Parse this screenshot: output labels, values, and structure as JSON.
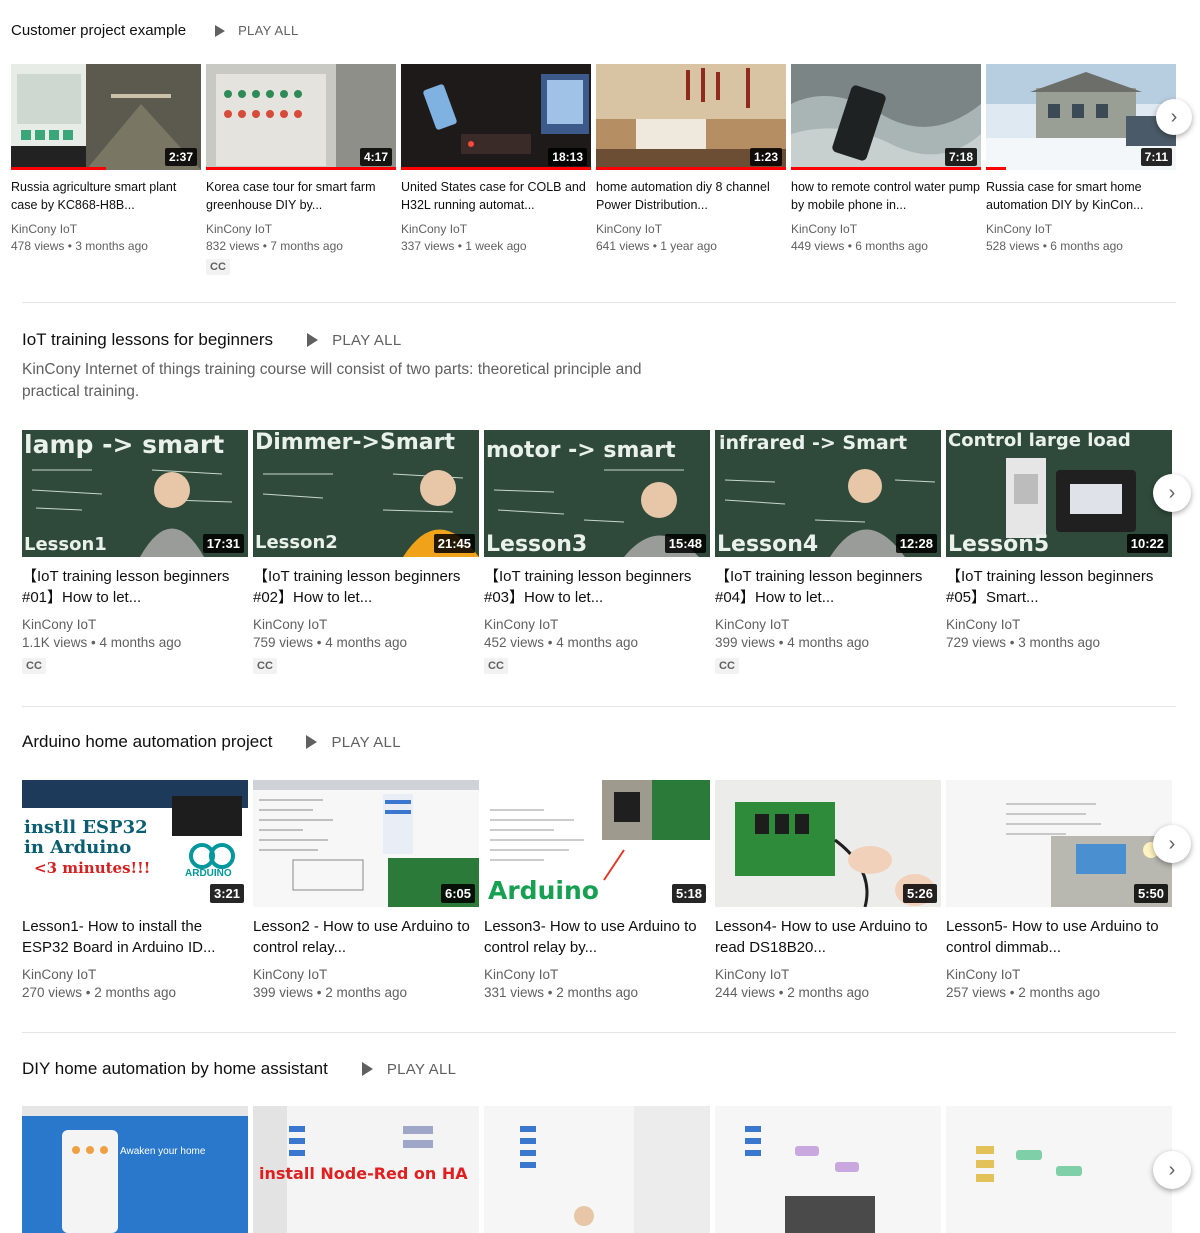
{
  "shelves": [
    {
      "title": "Customer project example",
      "play_all": "PLAY ALL",
      "videos": [
        {
          "title": "Russia agriculture smart plant case by KC868-H8B...",
          "channel": "KinCony IoT",
          "meta": "478 views • 3 months ago",
          "duration": "2:37",
          "cc": ""
        },
        {
          "title": "Korea case tour for smart farm greenhouse DIY by...",
          "channel": "KinCony IoT",
          "meta": "832 views • 7 months ago",
          "duration": "4:17",
          "cc": "CC"
        },
        {
          "title": "United States case for COLB and H32L running automat...",
          "channel": "KinCony IoT",
          "meta": "337 views • 1 week ago",
          "duration": "18:13",
          "cc": ""
        },
        {
          "title": "home automation diy 8 channel Power Distribution...",
          "channel": "KinCony IoT",
          "meta": "641 views • 1 year ago",
          "duration": "1:23",
          "cc": ""
        },
        {
          "title": "how to remote control water pump by mobile phone in...",
          "channel": "KinCony IoT",
          "meta": "449 views • 6 months ago",
          "duration": "7:18",
          "cc": ""
        },
        {
          "title": "Russia case for smart home automation DIY by KinCon...",
          "channel": "KinCony IoT",
          "meta": "528 views • 6 months ago",
          "duration": "7:11",
          "cc": ""
        }
      ]
    },
    {
      "title": "IoT training lessons for beginners",
      "play_all": "PLAY ALL",
      "description": "KinCony Internet of things training course will consist of two parts: theoretical principle and practical training.",
      "videos": [
        {
          "title": "【IoT training lesson beginners #01】How to let...",
          "channel": "KinCony IoT",
          "meta": "1.1K views • 4 months ago",
          "duration": "17:31",
          "cc": "CC",
          "thumb_top": "lamp -> smart",
          "thumb_bottom": "Lesson1"
        },
        {
          "title": "【IoT training lesson beginners #02】How to let...",
          "channel": "KinCony IoT",
          "meta": "759 views • 4 months ago",
          "duration": "21:45",
          "cc": "CC",
          "thumb_top": "Dimmer->Smart",
          "thumb_bottom": "Lesson2"
        },
        {
          "title": "【IoT training lesson beginners #03】How to let...",
          "channel": "KinCony IoT",
          "meta": "452 views • 4 months ago",
          "duration": "15:48",
          "cc": "CC",
          "thumb_top": "motor -> smart",
          "thumb_bottom": "Lesson3"
        },
        {
          "title": "【IoT training lesson beginners #04】How to let...",
          "channel": "KinCony IoT",
          "meta": "399 views • 4 months ago",
          "duration": "12:28",
          "cc": "CC",
          "thumb_top": "infrared -> Smart",
          "thumb_bottom": "Lesson4"
        },
        {
          "title": "【IoT training lesson beginners #05】Smart...",
          "channel": "KinCony IoT",
          "meta": "729 views • 3 months ago",
          "duration": "10:22",
          "cc": "",
          "thumb_top": "Control large load",
          "thumb_bottom": "Lesson5"
        }
      ]
    },
    {
      "title": "Arduino home automation project",
      "play_all": "PLAY ALL",
      "videos": [
        {
          "title": "Lesson1- How to install the ESP32 Board in Arduino ID...",
          "channel": "KinCony IoT",
          "meta": "270 views • 2 months ago",
          "duration": "3:21",
          "cc": "",
          "thumb_lines": [
            "instll ESP32",
            "in Arduino",
            "<3 minutes!!!"
          ],
          "thumb_logo": "ARDUINO"
        },
        {
          "title": "Lesson2 - How to use Arduino to control relay...",
          "channel": "KinCony IoT",
          "meta": "399 views • 2 months ago",
          "duration": "6:05",
          "cc": ""
        },
        {
          "title": "Lesson3- How to use Arduino to control relay by...",
          "channel": "KinCony IoT",
          "meta": "331 views • 2 months ago",
          "duration": "5:18",
          "cc": "",
          "thumb_word": "Arduino"
        },
        {
          "title": "Lesson4- How to use Arduino to read DS18B20...",
          "channel": "KinCony IoT",
          "meta": "244 views • 2 months ago",
          "duration": "5:26",
          "cc": ""
        },
        {
          "title": "Lesson5- How to use Arduino to control dimmab...",
          "channel": "KinCony IoT",
          "meta": "257 views • 2 months ago",
          "duration": "5:50",
          "cc": ""
        }
      ]
    },
    {
      "title": "DIY home automation by home assistant",
      "play_all": "PLAY ALL",
      "videos": [
        {
          "thumb_text": "Awaken your home"
        },
        {
          "thumb_text": "install Node-Red on HA"
        },
        {},
        {},
        {}
      ]
    }
  ],
  "icons": {
    "play": "play-icon",
    "next": "chevron-right-icon"
  },
  "colors": {
    "accent_red": "#ff0000",
    "text_secondary": "#606060",
    "chalkboard": "#2f4a3a",
    "chalk_text": "#d9e6dc"
  }
}
